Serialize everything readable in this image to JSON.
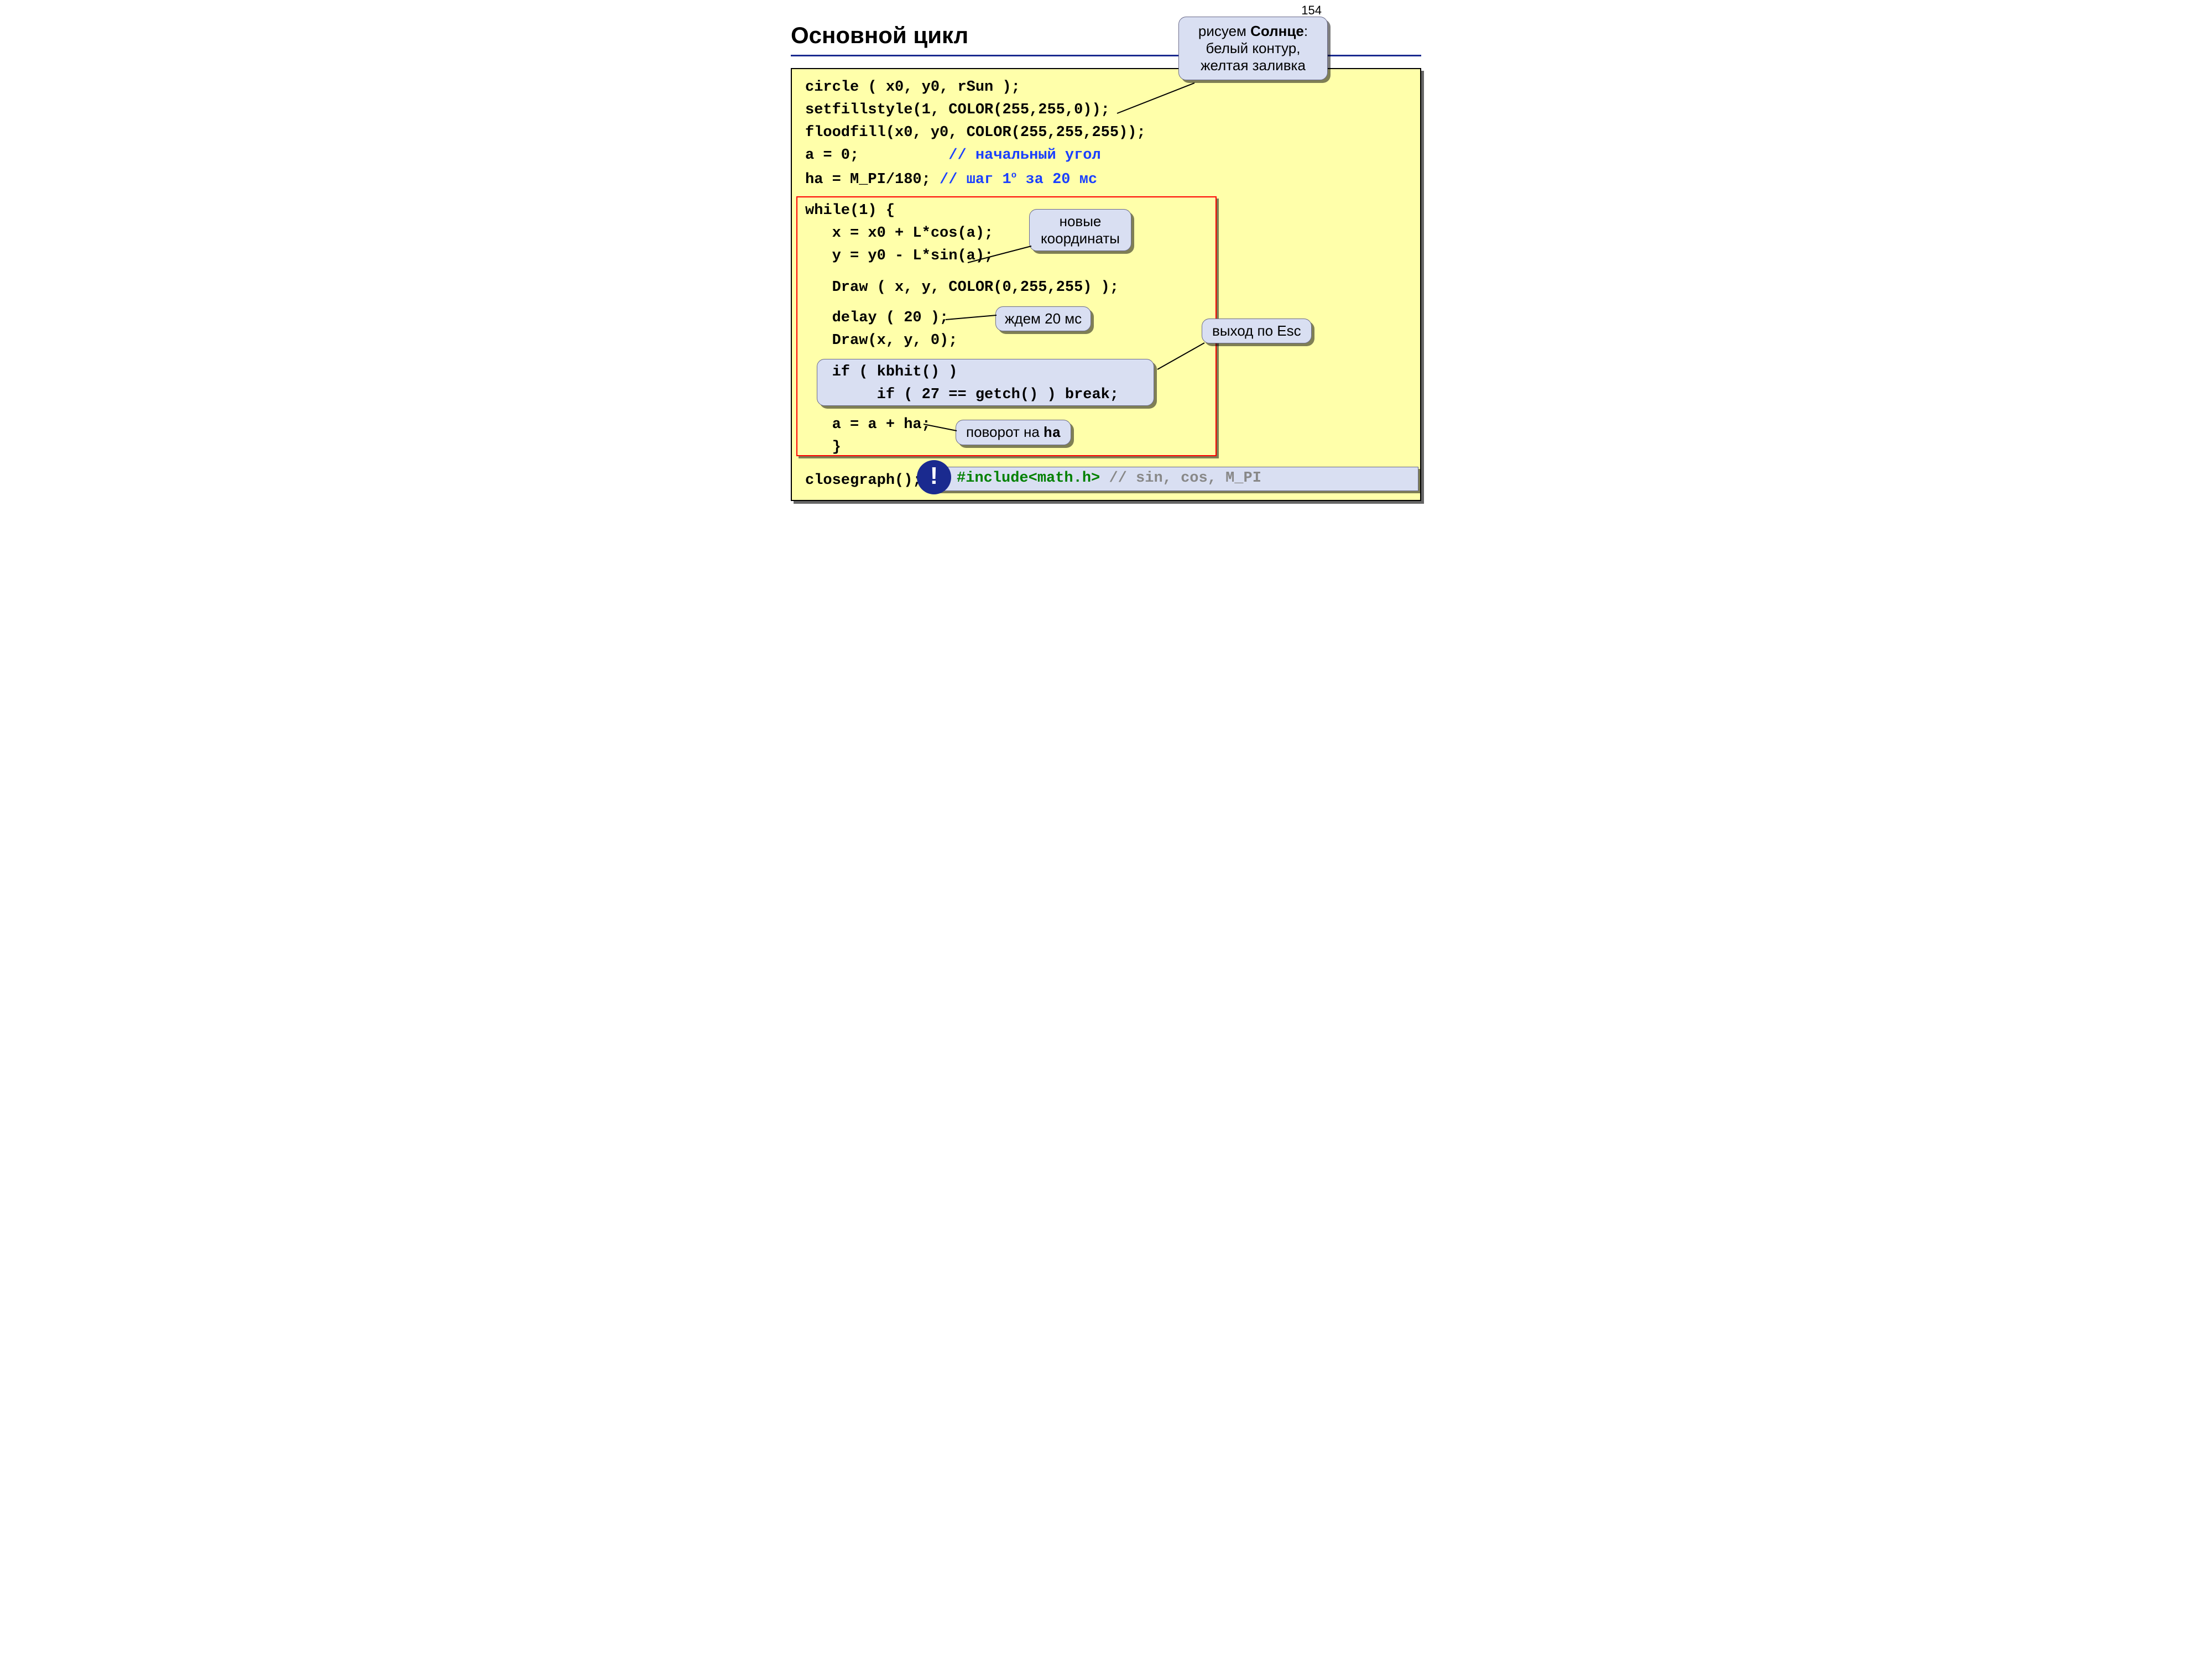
{
  "pageNumber": "154",
  "title": "Основной цикл",
  "code": {
    "l1": "circle ( x0, y0, rSun );",
    "l2": "setfillstyle(1, COLOR(255,255,0));",
    "l3": "floodfill(x0, y0, COLOR(255,255,255));",
    "l4a": "a = 0;          ",
    "l4b": "// начальный угол",
    "l5a": "ha = M_PI/180; ",
    "l5b_a": "// шаг 1",
    "l5b_sup": "о",
    "l5b_b": " за 20 мс",
    "l6": "while(1) {",
    "l7": "   x = x0 + L*cos(a);",
    "l8": "   y = y0 - L*sin(a);",
    "l9": "   Draw ( x, y, COLOR(0,255,255) );",
    "l10": "   delay ( 20 );",
    "l11": "   Draw(x, y, 0);",
    "l12": "   if ( kbhit() )",
    "l13": "        if ( 27 == getch() ) break;",
    "l14": "   a = a + ha;",
    "l15": "   }",
    "l16": "closegraph();"
  },
  "callouts": {
    "sun_a": "рисуем ",
    "sun_b": "Солнце",
    "sun_c": ":",
    "sun_d": "белый контур,",
    "sun_e": "желтая заливка",
    "coords_a": "новые",
    "coords_b": "координаты",
    "wait": "ждем 20 мс",
    "esc": "выход по Esc",
    "turn_a": "поворот на ",
    "turn_b": "ha"
  },
  "include": {
    "directive": "#include<math.h>",
    "comment": " // sin, cos, M_PI"
  },
  "bang": "!"
}
